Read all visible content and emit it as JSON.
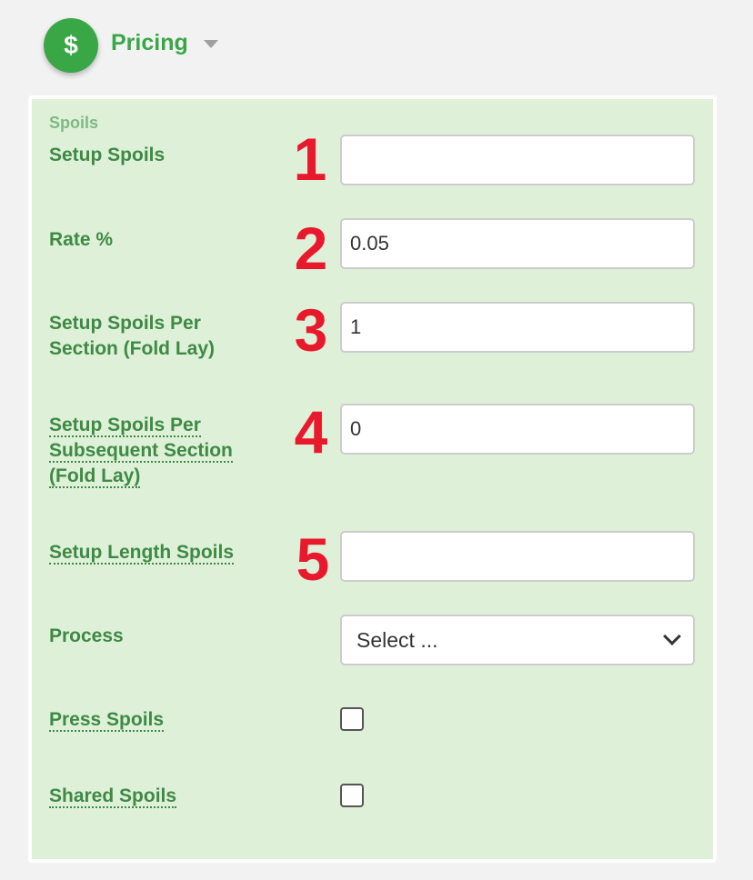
{
  "header": {
    "icon_glyph": "$",
    "title": "Pricing"
  },
  "section": {
    "label": "Spoils"
  },
  "fields": {
    "setup_spoils": {
      "label": "Setup Spoils",
      "badge": "1",
      "value": ""
    },
    "rate": {
      "label": "Rate %",
      "badge": "2",
      "value": "0.05"
    },
    "setup_per_section": {
      "label_line1": "Setup Spoils Per",
      "label_line2": "Section (Fold Lay)",
      "badge": "3",
      "value": "1"
    },
    "setup_per_subsequent": {
      "label_line1": "Setup Spoils Per",
      "label_line2": "Subsequent Section",
      "label_line3": "(Fold Lay)",
      "badge": "4",
      "value": "0"
    },
    "setup_length": {
      "label": "Setup Length Spoils",
      "badge": "5",
      "value": ""
    },
    "process": {
      "label": "Process",
      "selected": "Select ..."
    },
    "press_spoils": {
      "label": "Press Spoils",
      "checked": false
    },
    "shared_spoils": {
      "label": "Shared Spoils",
      "checked": false
    }
  },
  "colors": {
    "accent": "#3aa747",
    "panel_bg": "#dff0d8",
    "badge_red": "#e8192c"
  },
  "icons": {
    "logo": "dollar-icon",
    "caret": "caret-down-icon",
    "select_chevron": "chevron-down-icon"
  }
}
